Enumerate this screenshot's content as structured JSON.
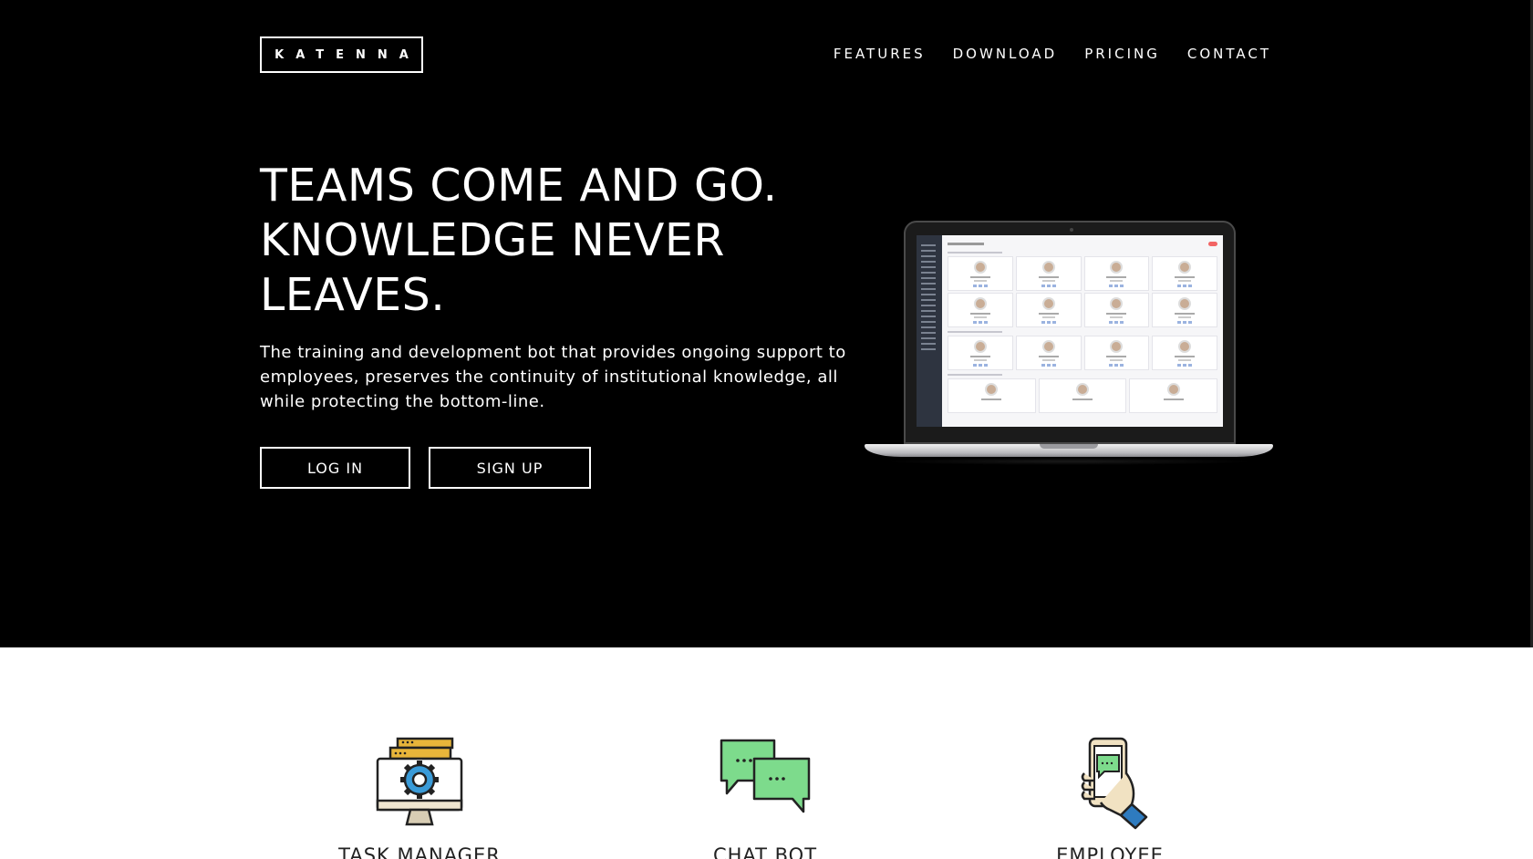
{
  "brand": {
    "logo_text": "KATENNA"
  },
  "nav": [
    {
      "label": "FEATURES"
    },
    {
      "label": "DOWNLOAD"
    },
    {
      "label": "PRICING"
    },
    {
      "label": "CONTACT"
    }
  ],
  "hero": {
    "headline_lines": [
      "TEAMS COME AND GO.",
      "KNOWLEDGE NEVER",
      "LEAVES."
    ],
    "subtext": "The training and development bot that provides ongoing support to employees, preserves the continuity of institutional knowledge, all while protecting the bottom-line.",
    "login_label": "LOG IN",
    "signup_label": "SIGN UP"
  },
  "features": [
    {
      "label": "TASK MANAGER",
      "icon": "task-manager-icon"
    },
    {
      "label": "CHAT BOT",
      "icon": "chat-bot-icon"
    },
    {
      "label": "EMPLOYEE PORTAL",
      "icon": "employee-portal-icon"
    }
  ],
  "colors": {
    "hero_bg": "#000000",
    "page_bg": "#ffffff",
    "accent_gold": "#e8b53a",
    "accent_green": "#7ddb8c",
    "accent_blue": "#2e7bbf"
  }
}
